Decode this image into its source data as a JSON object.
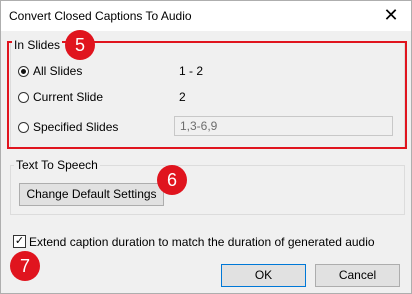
{
  "dialog": {
    "title": "Convert Closed Captions To Audio",
    "close_glyph": "✕"
  },
  "in_slides": {
    "label": "In Slides",
    "badge": "5",
    "options": [
      {
        "label": "All Slides",
        "value": "1 - 2",
        "selected": true
      },
      {
        "label": "Current Slide",
        "value": "2",
        "selected": false
      },
      {
        "label": "Specified Slides",
        "selected": false
      }
    ],
    "specified_placeholder": "1,3-6,9"
  },
  "text_to_speech": {
    "label": "Text To Speech",
    "button_label": "Change Default Settings",
    "badge": "6"
  },
  "extend_option": {
    "label": "Extend caption duration to match the duration of generated audio",
    "checked": true,
    "check_glyph": "✓",
    "badge": "7"
  },
  "buttons": {
    "ok": "OK",
    "cancel": "Cancel"
  },
  "colors": {
    "highlight": "#e0141e",
    "dialog_bg": "#f0f0f0"
  }
}
